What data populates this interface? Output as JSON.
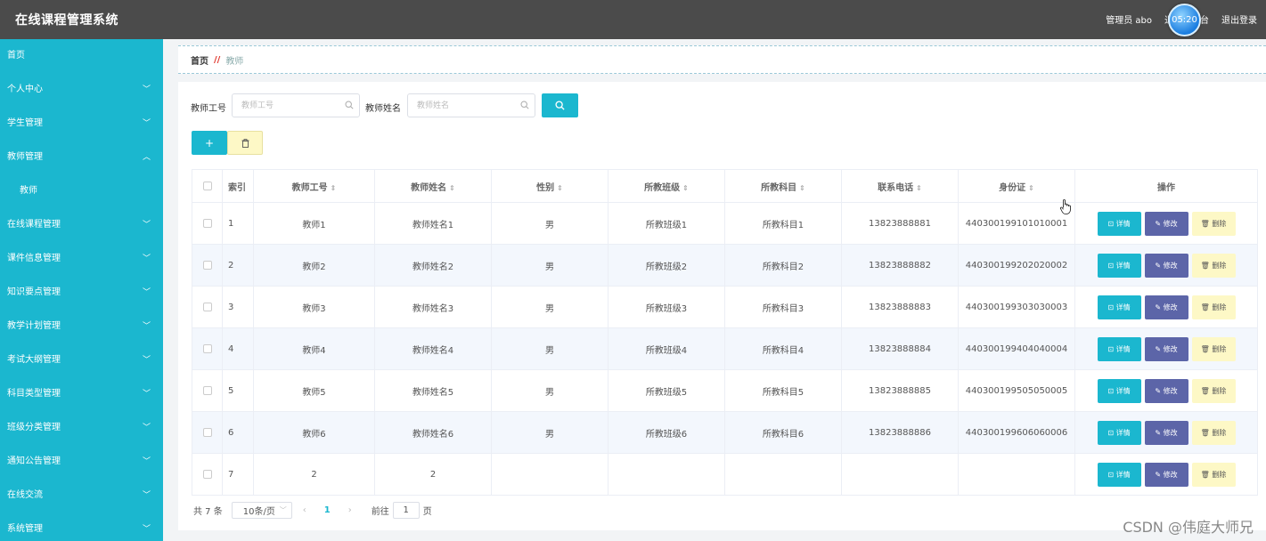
{
  "header": {
    "title": "在线课程管理系统",
    "user": "管理员 abo",
    "back_link": "退出到前台",
    "logout": "退出登录",
    "clock": "05:20"
  },
  "sidebar": {
    "items": [
      {
        "label": "首页",
        "chevron": ""
      },
      {
        "label": "个人中心",
        "chevron": "﹀"
      },
      {
        "label": "学生管理",
        "chevron": "﹀"
      },
      {
        "label": "教师管理",
        "chevron": "︿"
      },
      {
        "label": "教师",
        "chevron": ""
      },
      {
        "label": "在线课程管理",
        "chevron": "﹀"
      },
      {
        "label": "课件信息管理",
        "chevron": "﹀"
      },
      {
        "label": "知识要点管理",
        "chevron": "﹀"
      },
      {
        "label": "教学计划管理",
        "chevron": "﹀"
      },
      {
        "label": "考试大纲管理",
        "chevron": "﹀"
      },
      {
        "label": "科目类型管理",
        "chevron": "﹀"
      },
      {
        "label": "班级分类管理",
        "chevron": "﹀"
      },
      {
        "label": "通知公告管理",
        "chevron": "﹀"
      },
      {
        "label": "在线交流",
        "chevron": "﹀"
      },
      {
        "label": "系统管理",
        "chevron": "﹀"
      }
    ]
  },
  "breadcrumb": {
    "home": "首页",
    "sep": "//",
    "current": "教师"
  },
  "search": {
    "label_no": "教师工号",
    "placeholder_no": "教师工号",
    "label_name": "教师姓名",
    "placeholder_name": "教师姓名"
  },
  "actions": {
    "add": "+"
  },
  "table": {
    "headers": {
      "index": "索引",
      "no": "教师工号",
      "name": "教师姓名",
      "gender": "性别",
      "class": "所教班级",
      "subject": "所教科目",
      "phone": "联系电话",
      "idcard": "身份证",
      "ops": "操作"
    },
    "sort_glyph": "⇕",
    "op_labels": {
      "detail": "⊡ 详情",
      "edit": "✎ 修改",
      "del": "🗑 删除"
    },
    "rows": [
      {
        "index": "1",
        "no": "教师1",
        "name": "教师姓名1",
        "gender": "男",
        "class": "所教班级1",
        "subject": "所教科目1",
        "phone": "13823888881",
        "idcard": "440300199101010001"
      },
      {
        "index": "2",
        "no": "教师2",
        "name": "教师姓名2",
        "gender": "男",
        "class": "所教班级2",
        "subject": "所教科目2",
        "phone": "13823888882",
        "idcard": "440300199202020002"
      },
      {
        "index": "3",
        "no": "教师3",
        "name": "教师姓名3",
        "gender": "男",
        "class": "所教班级3",
        "subject": "所教科目3",
        "phone": "13823888883",
        "idcard": "440300199303030003"
      },
      {
        "index": "4",
        "no": "教师4",
        "name": "教师姓名4",
        "gender": "男",
        "class": "所教班级4",
        "subject": "所教科目4",
        "phone": "13823888884",
        "idcard": "440300199404040004"
      },
      {
        "index": "5",
        "no": "教师5",
        "name": "教师姓名5",
        "gender": "男",
        "class": "所教班级5",
        "subject": "所教科目5",
        "phone": "13823888885",
        "idcard": "440300199505050005"
      },
      {
        "index": "6",
        "no": "教师6",
        "name": "教师姓名6",
        "gender": "男",
        "class": "所教班级6",
        "subject": "所教科目6",
        "phone": "13823888886",
        "idcard": "440300199606060006"
      },
      {
        "index": "7",
        "no": "2",
        "name": "2",
        "gender": "",
        "class": "",
        "subject": "",
        "phone": "",
        "idcard": ""
      }
    ]
  },
  "pagination": {
    "total": "共 7 条",
    "page_size": "10条/页",
    "prev": "‹",
    "current": "1",
    "next": "›",
    "goto_prefix": "前往",
    "goto_value": "1",
    "goto_suffix": "页"
  },
  "watermark": "CSDN @伟庭大师兄",
  "colors": {
    "accent": "#1bb7cf",
    "header": "#4b4b4b",
    "edit": "#5c65a8",
    "delete": "#fdf8c6"
  }
}
